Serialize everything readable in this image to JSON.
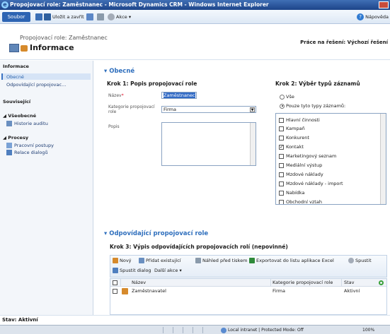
{
  "window": {
    "title": "Propojovací role: Zaměstnanec - Microsoft Dynamics CRM - Windows Internet Explorer"
  },
  "ribbon": {
    "file_tab": "Soubor",
    "save_close": "Uložit a zavřít",
    "actions": "Akce ▾",
    "help": "Nápověda"
  },
  "header": {
    "record_type": "Propojovací role: Zaměstnanec",
    "form_name": "Informace",
    "pane_label": "Práce na řešení: Výchozí řešení"
  },
  "nav": {
    "section_info": "Informace",
    "item_general": "Obecné",
    "item_matching": "Odpovídající propojovac...",
    "section_related": "Související",
    "group_general": "◢ Všeobecné",
    "item_audit": "Historie auditu",
    "group_processes": "◢ Procesy",
    "item_workflows": "Pracovní postupy",
    "item_dialogs": "Relace dialogů"
  },
  "general": {
    "section_title": "▾ Obecné",
    "step1": "Krok 1: Popis propojovací role",
    "name_label": "Název",
    "name_required": "*",
    "name_value": "Zaměstnanec",
    "category_label": "Kategorie propojovací role",
    "category_value": "Firma",
    "description_label": "Popis",
    "step2": "Krok 2: Výběr typů záznamů",
    "radio_all": "Vše",
    "radio_only": "Pouze tyto typy záznamů:",
    "record_types": [
      {
        "label": "Hlavní činnosti",
        "checked": false
      },
      {
        "label": "Kampaň",
        "checked": false
      },
      {
        "label": "Konkurent",
        "checked": false
      },
      {
        "label": "Kontakt",
        "checked": true
      },
      {
        "label": "Marketingový seznam",
        "checked": false
      },
      {
        "label": "Mediální výstup",
        "checked": false
      },
      {
        "label": "Mzdové náklady",
        "checked": false
      },
      {
        "label": "Mzdové náklady - import",
        "checked": false
      },
      {
        "label": "Nabídka",
        "checked": false
      },
      {
        "label": "Obchodní vztah",
        "checked": false
      }
    ]
  },
  "matching": {
    "section_title": "▾ Odpovídající propojovací role",
    "step3": "Krok 3: Výpis odpovídajících propojovacích rolí (nepovinné)",
    "toolbar": {
      "new": "Nový",
      "add_existing": "Přidat existující",
      "print_preview": "Náhled před tiskem",
      "export_excel": "Exportovat do listu aplikace Excel",
      "run": "Spustit",
      "run_dialog": "Spustit dialog",
      "more_actions": "Další akce ▾"
    },
    "columns": {
      "name": "Název",
      "category": "Kategorie propojovací role",
      "status": "Stav"
    },
    "rows": [
      {
        "name": "Zaměstnavatel",
        "category": "Firma",
        "status": "Aktivní"
      }
    ]
  },
  "status": {
    "record_status": "Stav: Aktivní",
    "zone": "Local intranet | Protected Mode: Off",
    "zoom": "100%"
  }
}
